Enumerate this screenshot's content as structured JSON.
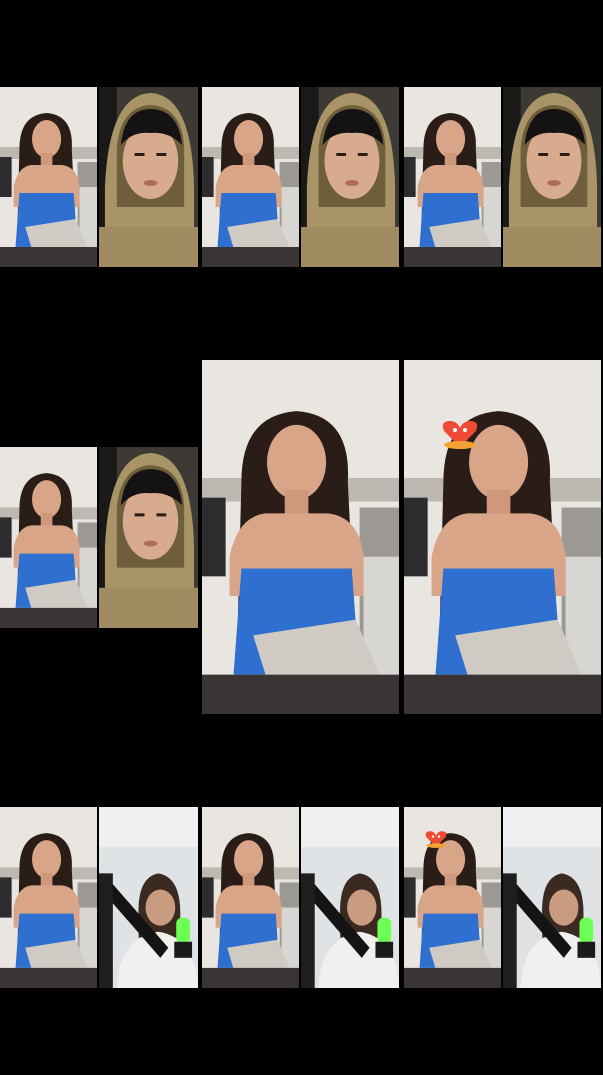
{
  "colors": {
    "background": "#000000",
    "wall": "#e9e6e2",
    "dress": "#2f6fd0",
    "hair": "#2a1c16",
    "skin": "#d9a588",
    "pillow": "#cfcac3",
    "hoodie": "#a89466",
    "sweater": "#f1f0ee",
    "mic_glow": "#6cff54",
    "heart": "#ef4a36"
  },
  "panels": [
    {
      "id": "row1-a-woman",
      "subject": "woman-blue-dress"
    },
    {
      "id": "row1-a-man",
      "subject": "man-hoodie"
    },
    {
      "id": "row1-b-woman",
      "subject": "woman-blue-dress"
    },
    {
      "id": "row1-b-man",
      "subject": "man-hoodie"
    },
    {
      "id": "row1-c-woman",
      "subject": "woman-blue-dress"
    },
    {
      "id": "row1-c-man",
      "subject": "man-hoodie"
    },
    {
      "id": "row2-woman",
      "subject": "woman-blue-dress"
    },
    {
      "id": "row2-man",
      "subject": "man-hoodie"
    },
    {
      "id": "row2-large-1",
      "subject": "woman-blue-dress"
    },
    {
      "id": "row2-large-2",
      "subject": "woman-blue-dress-with-heart-effect"
    },
    {
      "id": "row3-a-woman",
      "subject": "woman-blue-dress"
    },
    {
      "id": "row3-a-streamer",
      "subject": "woman-white-sweater-mic"
    },
    {
      "id": "row3-b-woman",
      "subject": "woman-blue-dress"
    },
    {
      "id": "row3-b-streamer",
      "subject": "woman-white-sweater-mic"
    },
    {
      "id": "row3-c-woman",
      "subject": "woman-blue-dress-with-heart-effect"
    },
    {
      "id": "row3-c-streamer",
      "subject": "woman-white-sweater-mic"
    }
  ]
}
